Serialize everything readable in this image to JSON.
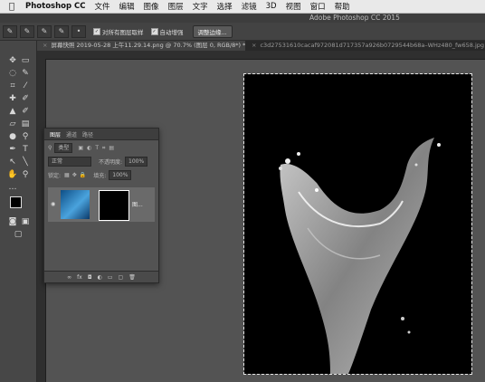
{
  "menubar": {
    "apple_icon": "apple-icon",
    "items": [
      "Photoshop CC",
      "文件",
      "编辑",
      "图像",
      "图层",
      "文字",
      "选择",
      "滤镜",
      "3D",
      "视图",
      "窗口",
      "帮助"
    ]
  },
  "title": "Adobe Photoshop CC 2015",
  "options": {
    "check1": "对所有图层取样",
    "check2": "自动增强",
    "button": "调整边缘..."
  },
  "tabs": [
    {
      "label": "屏幕快照 2019-05-28 上午11.29.14.png @ 70.7% (图层 0, RGB/8*) *",
      "close": "×"
    },
    {
      "label": "c3d27531610cacaf972081d717357a926b0729544b68a–WHz480_fw658.jpg @ 57%",
      "close": "×"
    }
  ],
  "layers_panel": {
    "tabs": [
      "图层",
      "通道",
      "路径"
    ],
    "filter_label": "类型",
    "blend_mode": "正常",
    "opacity_label": "不透明度:",
    "opacity_value": "100%",
    "lock_label": "锁定:",
    "fill_label": "填充:",
    "fill_value": "100%",
    "layer_name": "图..."
  },
  "colors": {
    "accent": "#4aa3dd"
  }
}
